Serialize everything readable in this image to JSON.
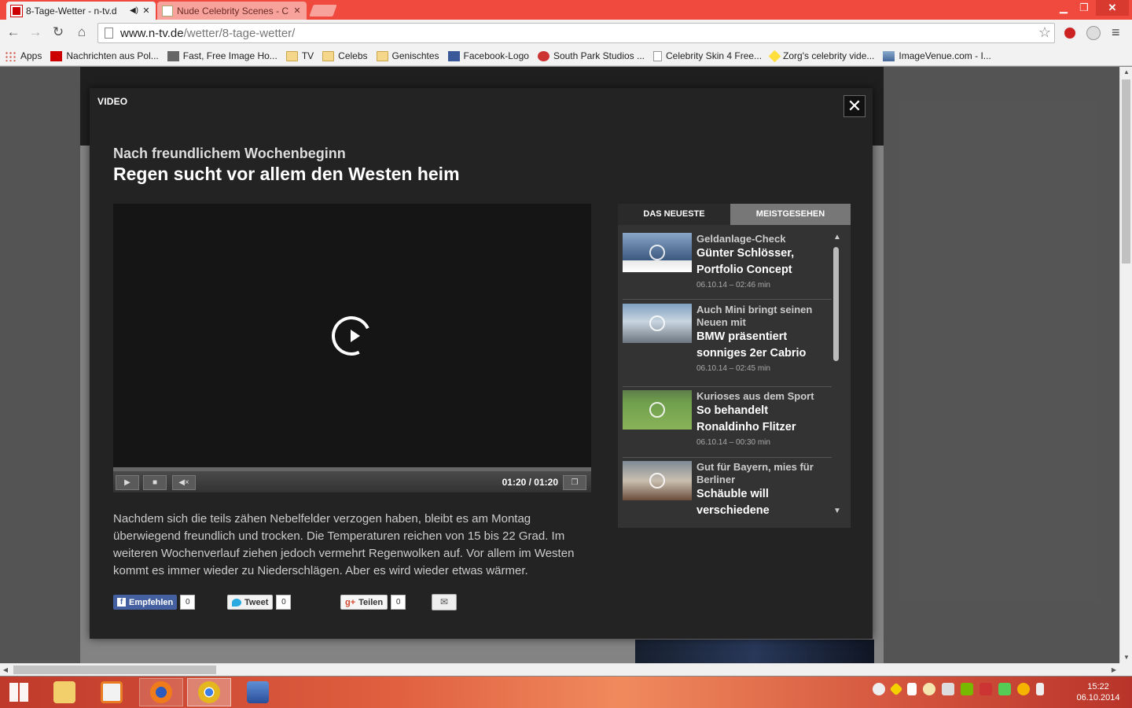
{
  "browser": {
    "tabs": [
      {
        "title": "8-Tage-Wetter - n-tv.d",
        "active": true
      },
      {
        "title": "Nude Celebrity Scenes - C",
        "active": false
      }
    ],
    "url_host": "www.n-tv.de",
    "url_path": "/wetter/8-tage-wetter/",
    "bookmarks": [
      {
        "label": "Apps",
        "icon": "apps-icon"
      },
      {
        "label": "Nachrichten aus Pol...",
        "icon": "ntv-icon"
      },
      {
        "label": "Fast, Free Image Ho...",
        "icon": "image-host-icon"
      },
      {
        "label": "TV",
        "icon": "folder-icon"
      },
      {
        "label": "Celebs",
        "icon": "folder-icon"
      },
      {
        "label": "Genischtes",
        "icon": "folder-icon"
      },
      {
        "label": "Facebook-Logo",
        "icon": "facebook-icon"
      },
      {
        "label": "South Park Studios ...",
        "icon": "southpark-icon"
      },
      {
        "label": "Celebrity Skin 4 Free...",
        "icon": "page-icon"
      },
      {
        "label": "Zorg's celebrity vide...",
        "icon": "star-icon"
      },
      {
        "label": "ImageVenue.com - I...",
        "icon": "imagevenue-icon"
      }
    ]
  },
  "modal": {
    "label": "VIDEO",
    "close_symbol": "✕",
    "kicker": "Nach freundlichem Wochenbeginn",
    "headline": "Regen sucht vor allem den Westen heim",
    "player": {
      "timecode": "01:20 / 01:20"
    },
    "description": "Nachdem sich die teils zähen Nebelfelder verzogen haben, bleibt es am Montag überwiegend freundlich und trocken. Die Temperaturen reichen von 15 bis 22 Grad. Im weiteren Wochenverlauf ziehen jedoch vermehrt Regenwolken auf. Vor allem im Westen kommt es immer wieder zu Niederschlägen. Aber es wird wieder etwas wärmer.",
    "share": {
      "facebook_label": "Empfehlen",
      "facebook_count": "0",
      "twitter_label": "Tweet",
      "twitter_count": "0",
      "gplus_label": "Teilen",
      "gplus_count": "0"
    }
  },
  "sidebar": {
    "tab_newest": "DAS NEUESTE",
    "tab_popular": "MEISTGESEHEN",
    "items": [
      {
        "kicker": "Geldanlage-Check",
        "title": "Günter Schlösser, Portfolio Concept",
        "date": "06.10.14 – 02:46 min"
      },
      {
        "kicker": "Auch Mini bringt seinen Neuen mit",
        "title": "BMW präsentiert sonniges 2er Cabrio",
        "date": "06.10.14 – 02:45 min"
      },
      {
        "kicker": "Kurioses aus dem Sport",
        "title": "So behandelt Ronaldinho Flitzer",
        "date": "06.10.14 – 00:30 min"
      },
      {
        "kicker": "Gut für Bayern, mies für Berliner",
        "title": "Schäuble will verschiedene",
        "date": ""
      }
    ]
  },
  "taskbar": {
    "clock_time": "15:22",
    "clock_date": "06.10.2014"
  }
}
